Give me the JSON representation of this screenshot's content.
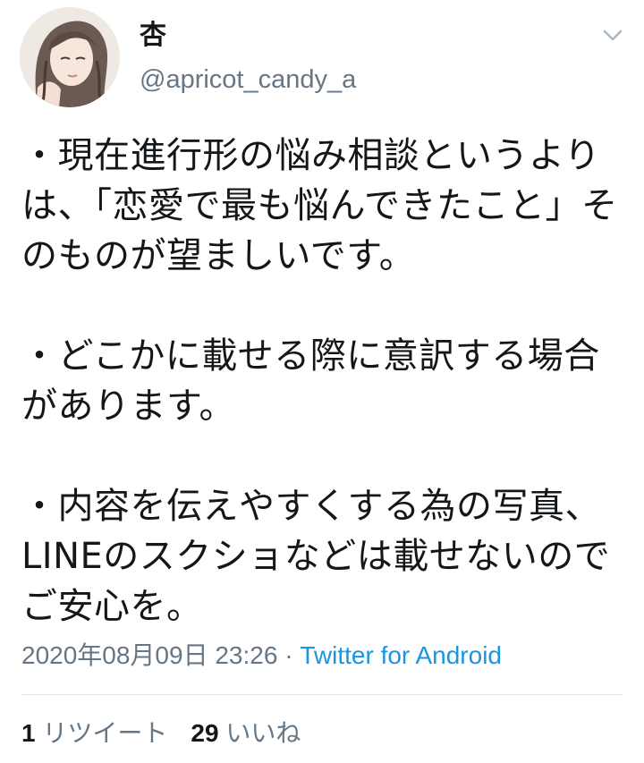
{
  "user": {
    "display_name": "杏",
    "handle": "@apricot_candy_a"
  },
  "tweet": {
    "text": "・現在進行形の悩み相談というよりは、「恋愛で最も悩んできたこと」そのものが望ましいです。\n\n・どこかに載せる際に意訳する場合があります。\n\n・内容を伝えやすくする為の写真、LINEのスクショなどは載せないのでご安心を。",
    "timestamp": "2020年08月09日 23:26",
    "separator": " · ",
    "source": "Twitter for Android"
  },
  "stats": {
    "retweet_count": "1",
    "retweet_label": "リツイート",
    "like_count": "29",
    "like_label": "いいね"
  },
  "icons": {
    "menu": "chevron-down-icon",
    "avatar": "avatar"
  },
  "colors": {
    "text": "#14171a",
    "muted": "#657786",
    "link": "#1b95e0",
    "divider": "#e1e8ed"
  }
}
